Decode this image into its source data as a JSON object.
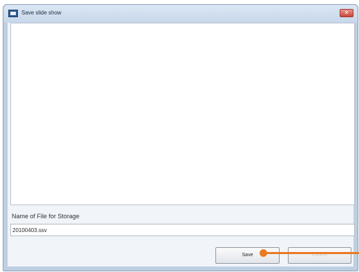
{
  "window": {
    "title": "Save slide show",
    "close_glyph": "✕"
  },
  "storage": {
    "label": "Name of File for Storage",
    "filename_value": "20100403.ssv"
  },
  "buttons": {
    "save_label": "Save",
    "cancel_label": "Cancel"
  },
  "colors": {
    "callout": "#ea7a23",
    "title_close": "#c8473a"
  }
}
